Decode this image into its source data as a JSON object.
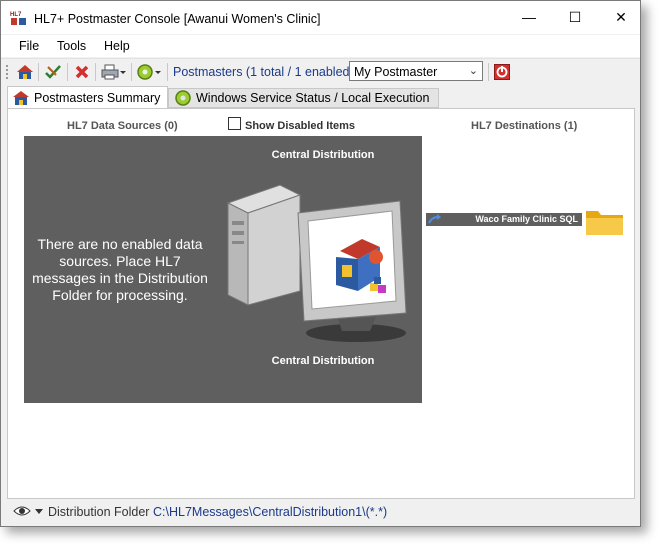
{
  "window": {
    "title": "HL7+ Postmaster Console [Awanui Women's Clinic]",
    "controls": {
      "minimize": "—",
      "maximize": "☐",
      "close": "✕"
    }
  },
  "menu": [
    "File",
    "Tools",
    "Help"
  ],
  "toolbar": {
    "icons": [
      "home-icon",
      "edit-check-icon",
      "delete-icon",
      "print-icon",
      "settings-gear-icon",
      "power-icon"
    ],
    "postmasters_label": "Postmasters (1 total / 1 enabled)",
    "postmaster_select": "My Postmaster"
  },
  "tabs": [
    {
      "label": "Postmasters Summary",
      "icon": "home-icon",
      "active": true
    },
    {
      "label": "Windows Service Status / Local Execution",
      "icon": "gear-icon",
      "active": false
    }
  ],
  "summary": {
    "sources_header": "HL7 Data Sources (0)",
    "show_disabled_label": "Show Disabled Items",
    "show_disabled_checked": false,
    "destinations_header": "HL7 Destinations (1)",
    "empty_message": "There are no enabled data sources. Place HL7 messages in the Distribution Folder for processing.",
    "center_label_top": "Central Distribution",
    "center_label_bottom": "Central Distribution",
    "destinations": [
      {
        "name": "Waco Family Clinic SQL"
      }
    ]
  },
  "status": {
    "label": "Distribution Folder",
    "path": "C:\\HL7Messages\\CentralDistribution1\\(*.*)"
  },
  "colors": {
    "panel_bg": "#5f5f5f",
    "link_blue": "#1a3a8a",
    "folder_yellow": "#f2c12e"
  }
}
